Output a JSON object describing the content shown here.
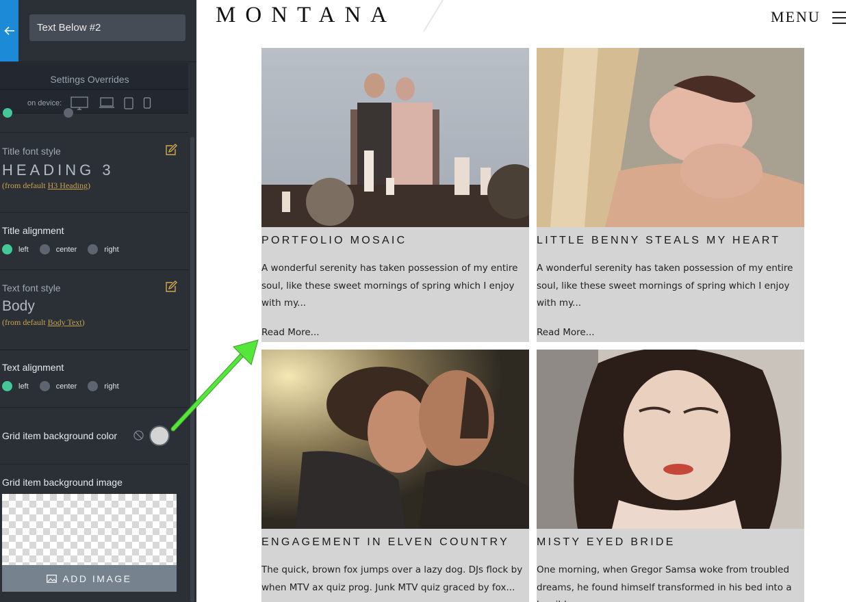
{
  "sidebar": {
    "title_value": "Text Below #2",
    "overrides_title": "Settings Overrides",
    "device_label": "on device:",
    "title_font": {
      "label": "Title font style",
      "value": "HEADING 3",
      "from_prefix": "(from default ",
      "from_link": "H3 Heading",
      "from_suffix": ")"
    },
    "title_align": {
      "label": "Title alignment",
      "options": [
        "left",
        "center",
        "right"
      ],
      "selected": "left"
    },
    "text_font": {
      "label": "Text font style",
      "value": "Body",
      "from_prefix": "(from default ",
      "from_link": "Body Text",
      "from_suffix": ")"
    },
    "text_align": {
      "label": "Text alignment",
      "options": [
        "left",
        "center",
        "right"
      ],
      "selected": "left"
    },
    "bg_color": {
      "label": "Grid item background color",
      "value": "#d4d4d4"
    },
    "bg_image": {
      "label": "Grid item background image",
      "button": "ADD IMAGE"
    }
  },
  "site": {
    "logo": "MONTANA",
    "menu": "MENU",
    "cards": [
      {
        "title": "PORTFOLIO MOSAIC",
        "body": "A wonderful serenity has taken possession of my entire soul, like these sweet mornings of spring which I enjoy with my...",
        "more": "Read More..."
      },
      {
        "title": "LITTLE BENNY STEALS MY HEART",
        "body": "A wonderful serenity has taken possession of my entire soul, like these sweet mornings of spring which I enjoy with my...",
        "more": "Read More..."
      },
      {
        "title": "ENGAGEMENT IN ELVEN COUNTRY",
        "body": "The quick, brown fox jumps over a lazy dog. DJs flock by when MTV ax quiz prog. Junk MTV quiz graced by fox...",
        "more": ""
      },
      {
        "title": "MISTY EYED BRIDE",
        "body": "One morning, when Gregor Samsa woke from troubled dreams, he found himself transformed in his bed into a horrible...",
        "more": ""
      }
    ]
  },
  "colors": {
    "accent_blue": "#1c8ad6",
    "radio_on": "#43c896",
    "card_bg": "#d4d4d4",
    "arrow": "#55e63c",
    "link_gold": "#c8a24a"
  }
}
